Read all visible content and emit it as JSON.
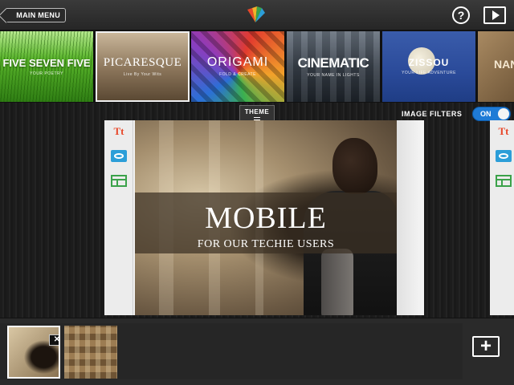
{
  "topbar": {
    "main_menu_label": "MAIN MENU",
    "help_label": "?"
  },
  "themes": [
    {
      "name": "FIVE SEVEN FIVE",
      "subtitle": "YOUR POETRY"
    },
    {
      "name": "PICARESQUE",
      "subtitle": "Live By Your Wits"
    },
    {
      "name": "ORIGAMI",
      "subtitle": "FOLD & CREATE"
    },
    {
      "name": "CINEMATIC",
      "subtitle": "YOUR NAME IN LIGHTS"
    },
    {
      "name": "ZISSOU",
      "subtitle": "YOUR LIFE ADVENTURE"
    },
    {
      "name": "NAN",
      "subtitle": ""
    }
  ],
  "theme_tab": {
    "label": "THEME"
  },
  "image_filters": {
    "label": "IMAGE FILTERS",
    "state": "ON"
  },
  "slide": {
    "title": "MOBILE",
    "subtitle": "FOR OUR TECHIE USERS",
    "text_tool_label": "Tt"
  },
  "next_card": {
    "text_tool_label": "Tt"
  },
  "bottom": {
    "thumb_close_label": "✕",
    "add_label": "+"
  },
  "colors": {
    "accent_blue": "#1f7bd6",
    "text_tool": "#e8482a",
    "photo_tool": "#2c9ed8",
    "layout_tool": "#3ba24a"
  }
}
